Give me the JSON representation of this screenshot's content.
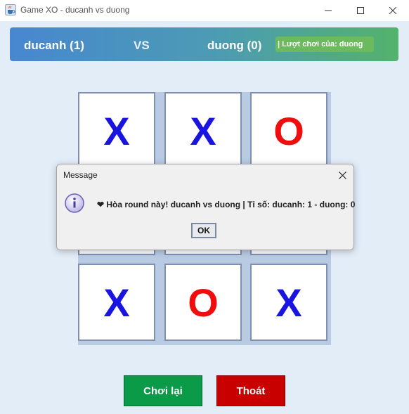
{
  "window": {
    "title": "Game XO - ducanh vs duong",
    "icon": "java-cup-icon",
    "controls": [
      "minimize-icon",
      "maximize-icon",
      "close-icon"
    ]
  },
  "banner": {
    "player1": "ducanh (1)",
    "vs": "VS",
    "player2": "duong (0)",
    "turn": "| Lượt chơi của: duong",
    "colors": {
      "start": "#4787d0",
      "end": "#53b36b"
    }
  },
  "board": {
    "cells": [
      "X",
      "X",
      "O",
      "",
      "",
      "",
      "X",
      "O",
      "X"
    ],
    "colors": {
      "x": "#1a14e0",
      "o": "#f00d0d"
    }
  },
  "buttons": {
    "replay": "Chơi lại",
    "exit": "Thoát",
    "colors": {
      "replay": "#0a9a48",
      "exit": "#c80000"
    }
  },
  "dialog": {
    "title": "Message",
    "icon": "info-icon",
    "message": "❤ Hòa round này! ducanh vs duong | Tỉ số: ducanh: 1 - duong: 0",
    "ok": "OK"
  }
}
